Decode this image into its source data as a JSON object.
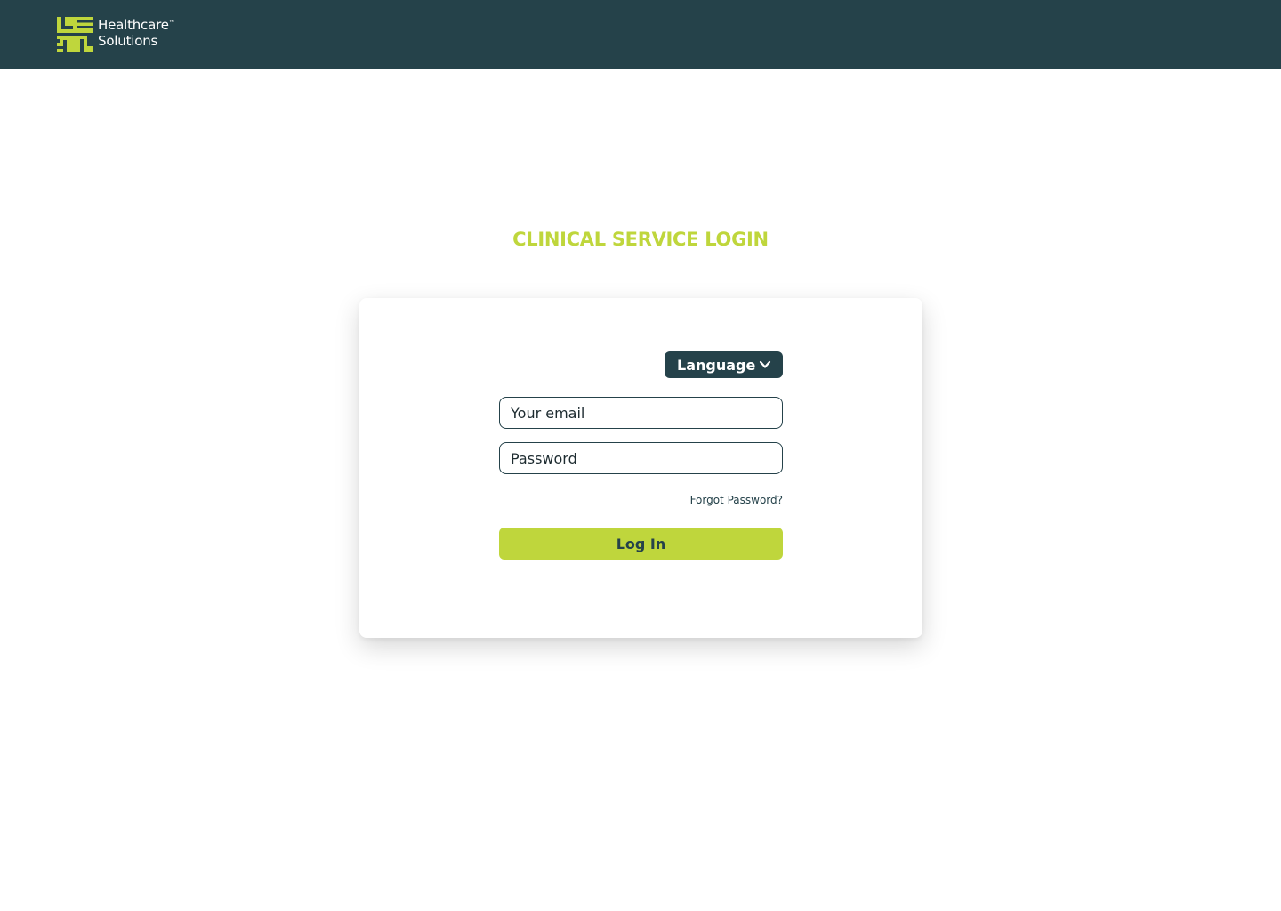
{
  "brand": {
    "logo_letters": [
      "L",
      "E",
      "A",
      "N"
    ],
    "line1": "Healthcare",
    "trademark": "™",
    "line2": "Solutions",
    "colors": {
      "header_bg": "#25424a",
      "accent": "#bfd63c",
      "text_dark": "#25424a"
    }
  },
  "page": {
    "title": "CLINICAL SERVICE LOGIN"
  },
  "login_form": {
    "language_label": "Language",
    "language_icon": "chevron-down-icon",
    "email_placeholder": "Your email",
    "password_placeholder": "Password",
    "forgot_password": "Forgot Password?",
    "login_label": "Log In"
  }
}
